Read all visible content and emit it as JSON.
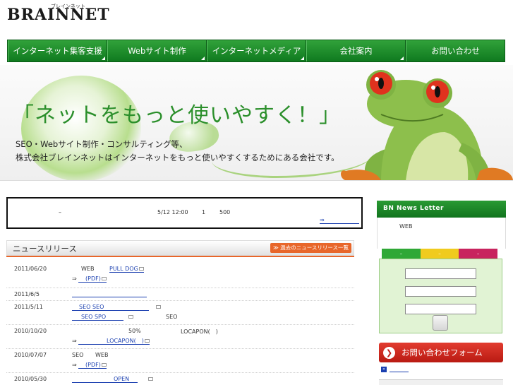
{
  "header": {
    "logo_text": "BRAINNET",
    "logo_kana": "ブレインネット"
  },
  "nav": {
    "items": [
      {
        "label": "インターネット集客支援"
      },
      {
        "label": "Webサイト制作"
      },
      {
        "label": "インターネットメディア"
      },
      {
        "label": "会社案内"
      },
      {
        "label": "お問い合わせ"
      }
    ]
  },
  "hero": {
    "title": "「ネットをもっと使いやすく！」",
    "subtitle_line1": "SEO・Webサイト制作・コンサルティング等、",
    "subtitle_line2": "株式会社ブレインネットはインターネットをもっと使いやすくするためにある会社です。"
  },
  "notice": {
    "dash": "–",
    "date": "5/12 12:00",
    "num1": "1",
    "num2": "500",
    "more_arrow": "⇒"
  },
  "news": {
    "heading": "ニュースリリース",
    "more_button": "≫ 過去のニュースリリース一覧",
    "rows": [
      {
        "date": "2011/06/20",
        "text1": "WEB",
        "link1": "PULL DOG",
        "arrow": "⇒",
        "link2": "(PDF)"
      },
      {
        "date": "2011/6/5"
      },
      {
        "date": "2011/5/11",
        "link1": "SEO SEO",
        "link2": "SEO SPO",
        "text1": "SEO"
      },
      {
        "date": "2010/10/20",
        "text1": "50%",
        "text2": "LOCAPON(　)",
        "arrow": "⇒",
        "link1": "LOCAPON(　)"
      },
      {
        "date": "2010/07/07",
        "text1": "SEO",
        "text2": "WEB",
        "arrow": "⇒",
        "link1": "(PDF)"
      },
      {
        "date": "2010/05/30",
        "link1": "OPEN"
      }
    ]
  },
  "sidebar": {
    "newsletter_title": "BN News Letter",
    "newsletter_text": "WEB",
    "tabs": [
      {
        "label": "–",
        "color": "#2fa836"
      },
      {
        "label": "–",
        "color": "#f0cb1e"
      },
      {
        "label": "–",
        "color": "#c8245e"
      }
    ],
    "contact_label": "お問い合わせフォーム",
    "contact_arrow": "❯",
    "link_icon": "»"
  },
  "colors": {
    "nav_green": "#1a8a28",
    "accent_orange": "#e8662a",
    "link_blue": "#1a3fb0",
    "contact_red": "#c8241a"
  }
}
